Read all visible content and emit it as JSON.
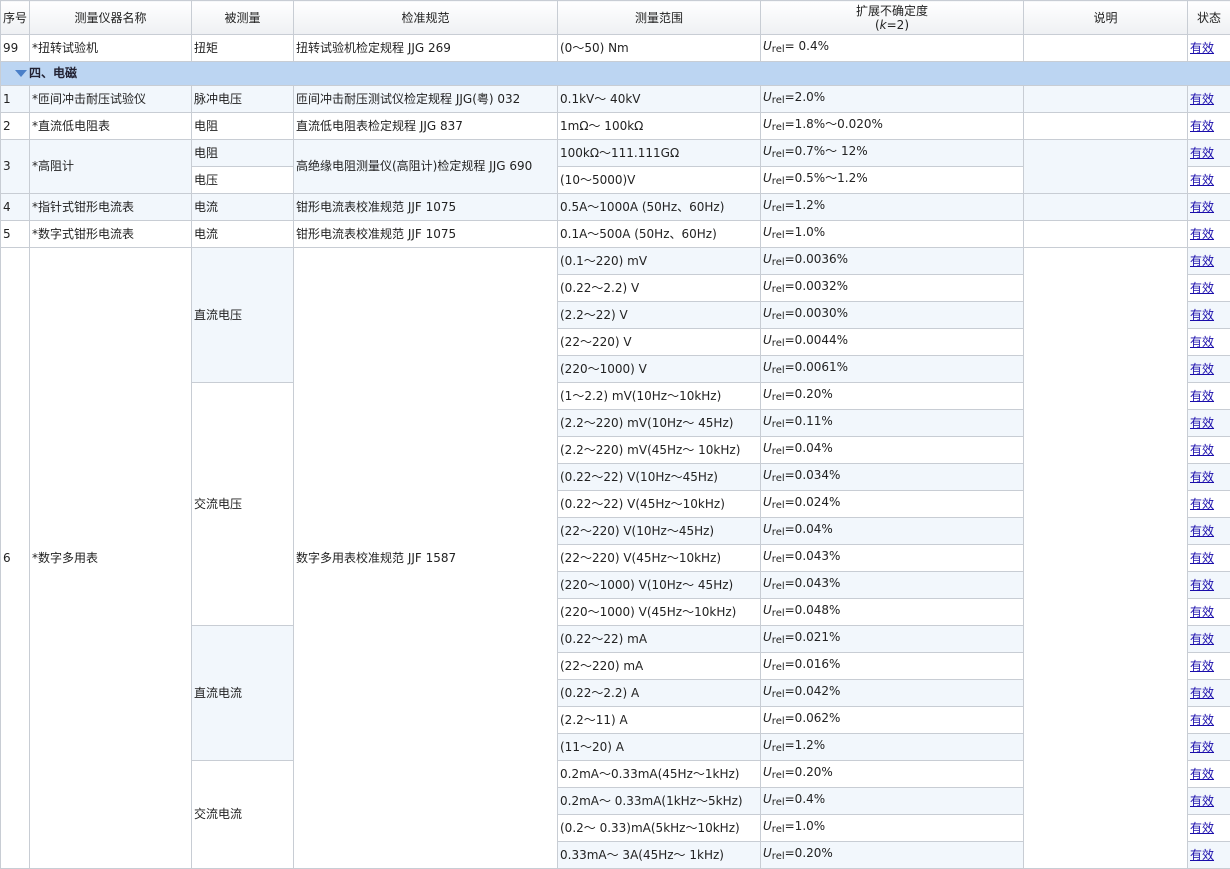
{
  "headers": {
    "no": "序号",
    "instrument": "测量仪器名称",
    "quantity": "被测量",
    "spec": "检准规范",
    "range": "测量范围",
    "unc_line1": "扩展不确定度",
    "unc_k": "k",
    "unc_keq": "=2",
    "note": "说明",
    "status": "状态"
  },
  "u_symbol": "U",
  "u_sub": "rel",
  "row99": {
    "no": "99",
    "instrument": "*扭转试验机",
    "quantity": "扭矩",
    "spec": "扭转试验机检定规程 JJG 269",
    "range": "(0～50) Nm",
    "unc": "= 0.4%",
    "status": "有效"
  },
  "section": {
    "title": "四、电磁"
  },
  "r1": {
    "no": "1",
    "instrument": "*匝间冲击耐压试验仪",
    "quantity": "脉冲电压",
    "spec": "匝间冲击耐压测试仪检定规程 JJG(粤) 032",
    "range": "0.1kV～ 40kV",
    "unc": "=2.0%",
    "status": "有效"
  },
  "r2": {
    "no": "2",
    "instrument": "*直流低电阻表",
    "quantity": "电阻",
    "spec": "直流低电阻表检定规程 JJG 837",
    "range": "1mΩ～ 100kΩ",
    "unc": "=1.8%～0.020%",
    "status": "有效"
  },
  "r3": {
    "no": "3",
    "instrument": "*高阻计",
    "spec": "高绝缘电阻测量仪(高阻计)检定规程 JJG 690",
    "a": {
      "quantity": "电阻",
      "range": "100kΩ～111.111GΩ",
      "unc": "=0.7%～ 12%",
      "status": "有效"
    },
    "b": {
      "quantity": "电压",
      "range": "(10～5000)V",
      "unc": "=0.5%～1.2%",
      "status": "有效"
    }
  },
  "r4": {
    "no": "4",
    "instrument": "*指针式钳形电流表",
    "quantity": "电流",
    "spec": "钳形电流表校准规范 JJF 1075",
    "range": "0.5A～1000A (50Hz、60Hz)",
    "unc": "=1.2%",
    "status": "有效"
  },
  "r5": {
    "no": "5",
    "instrument": "*数字式钳形电流表",
    "quantity": "电流",
    "spec": "钳形电流表校准规范 JJF 1075",
    "range": "0.1A～500A (50Hz、60Hz)",
    "unc": "=1.0%",
    "status": "有效"
  },
  "r6": {
    "no": "6",
    "instrument": "*数字多用表",
    "spec": "数字多用表校准规范 JJF 1587",
    "groups": {
      "dcv": "直流电压",
      "acv": "交流电压",
      "dci": "直流电流",
      "aci": "交流电流"
    },
    "rows": [
      {
        "range": "(0.1～220) mV",
        "unc": "=0.0036%",
        "status": "有效"
      },
      {
        "range": "(0.22～2.2) V",
        "unc": "=0.0032%",
        "status": "有效"
      },
      {
        "range": "(2.2～22) V",
        "unc": "=0.0030%",
        "status": "有效"
      },
      {
        "range": "(22～220) V",
        "unc": "=0.0044%",
        "status": "有效"
      },
      {
        "range": "(220～1000) V",
        "unc": "=0.0061%",
        "status": "有效"
      },
      {
        "range": "(1～2.2) mV(10Hz～10kHz)",
        "unc": "=0.20%",
        "status": "有效"
      },
      {
        "range": "(2.2～220) mV(10Hz～ 45Hz)",
        "unc": "=0.11%",
        "status": "有效"
      },
      {
        "range": "(2.2～220) mV(45Hz～ 10kHz)",
        "unc": "=0.04%",
        "status": "有效"
      },
      {
        "range": "(0.22～22) V(10Hz～45Hz)",
        "unc": "=0.034%",
        "status": "有效"
      },
      {
        "range": "(0.22～22) V(45Hz～10kHz)",
        "unc": "=0.024%",
        "status": "有效"
      },
      {
        "range": "(22～220) V(10Hz～45Hz)",
        "unc": "=0.04%",
        "status": "有效"
      },
      {
        "range": "(22～220) V(45Hz～10kHz)",
        "unc": "=0.043%",
        "status": "有效"
      },
      {
        "range": "(220～1000) V(10Hz～ 45Hz)",
        "unc": "=0.043%",
        "status": "有效"
      },
      {
        "range": "(220～1000) V(45Hz～10kHz)",
        "unc": "=0.048%",
        "status": "有效"
      },
      {
        "range": "(0.22～22) mA",
        "unc": "=0.021%",
        "status": "有效"
      },
      {
        "range": "(22～220) mA",
        "unc": "=0.016%",
        "status": "有效"
      },
      {
        "range": "(0.22～2.2) A",
        "unc": "=0.042%",
        "status": "有效"
      },
      {
        "range": "(2.2～11) A",
        "unc": "=0.062%",
        "status": "有效"
      },
      {
        "range": "(11～20) A",
        "unc": "=1.2%",
        "status": "有效"
      },
      {
        "range": "0.2mA～0.33mA(45Hz～1kHz)",
        "unc": "=0.20%",
        "status": "有效"
      },
      {
        "range": "0.2mA～ 0.33mA(1kHz～5kHz)",
        "unc": "=0.4%",
        "status": "有效"
      },
      {
        "range": "(0.2～ 0.33)mA(5kHz～10kHz)",
        "unc": "=1.0%",
        "status": "有效"
      },
      {
        "range": "0.33mA～ 3A(45Hz～ 1kHz)",
        "unc": "=0.20%",
        "status": "有效"
      }
    ]
  }
}
